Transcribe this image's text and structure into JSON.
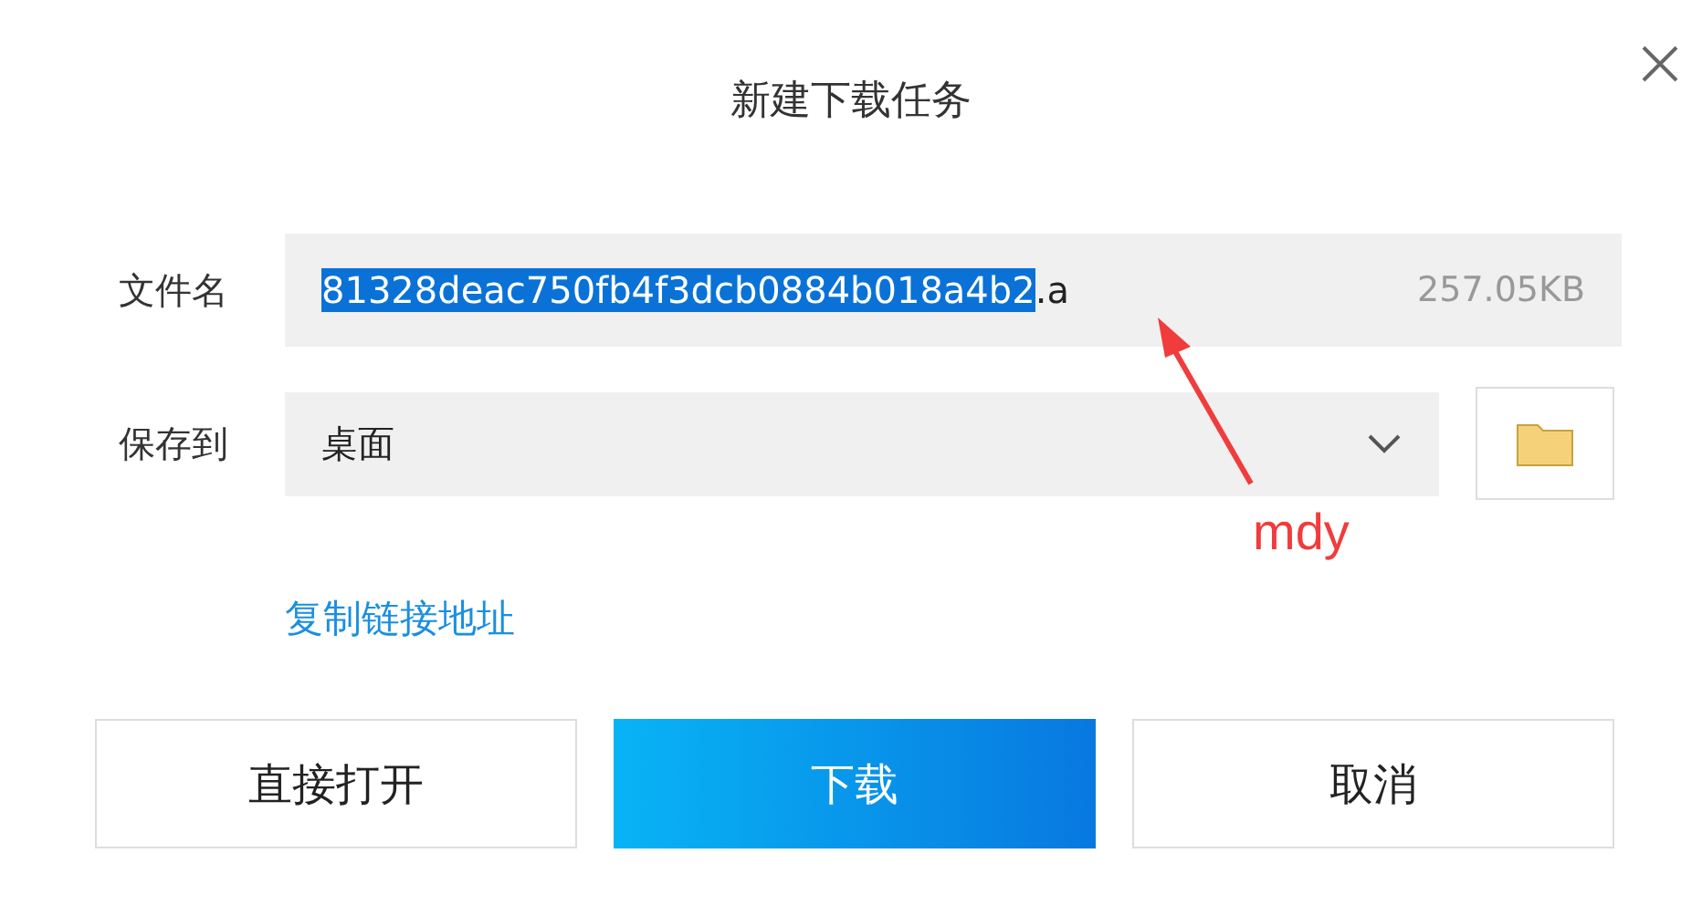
{
  "window": {
    "title": "新建下载任务"
  },
  "filename": {
    "label": "文件名",
    "selected_text": "81328deac750fb4f3dcb0884b018a4b2",
    "rest_text": ".a",
    "size": "257.05KB"
  },
  "save_to": {
    "label": "保存到",
    "value": "桌面"
  },
  "link": "复制链接地址",
  "buttons": [
    {
      "label": "直接打开",
      "kind": "plain"
    },
    {
      "label": "下载",
      "kind": "primary"
    },
    {
      "label": "取消",
      "kind": "plain"
    }
  ],
  "annotation": {
    "text": "mdy"
  }
}
